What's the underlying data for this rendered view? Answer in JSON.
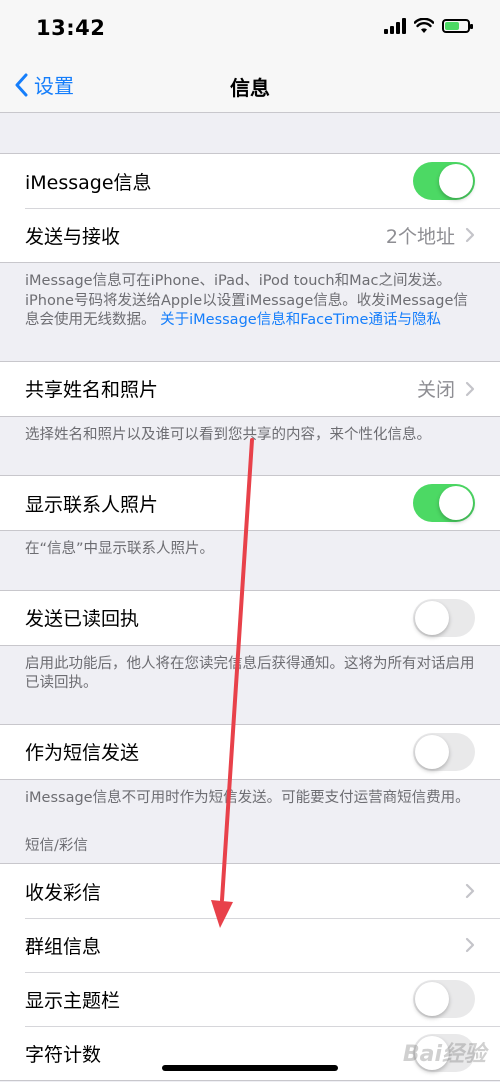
{
  "status_bar": {
    "time": "13:42"
  },
  "nav": {
    "back_label": "设置",
    "title": "信息"
  },
  "sections": {
    "imessage": {
      "toggle_label": "iMessage信息",
      "toggle_on": true,
      "send_receive_label": "发送与接收",
      "send_receive_value": "2个地址",
      "footer_text": "iMessage信息可在iPhone、iPad、iPod touch和Mac之间发送。iPhone号码将发送给Apple以设置iMessage信息。收发iMessage信息会使用无线数据。",
      "footer_link": "关于iMessage信息和FaceTime通话与隐私"
    },
    "share_name": {
      "label": "共享姓名和照片",
      "value": "关闭",
      "footer": "选择姓名和照片以及谁可以看到您共享的内容，来个性化信息。"
    },
    "contact_photos": {
      "label": "显示联系人照片",
      "toggle_on": true,
      "footer": "在“信息”中显示联系人照片。"
    },
    "read_receipts": {
      "label": "发送已读回执",
      "toggle_on": false,
      "footer": "启用此功能后，他人将在您读完信息后获得通知。这将为所有对话启用已读回执。"
    },
    "send_as_sms": {
      "label": "作为短信发送",
      "toggle_on": false,
      "footer": "iMessage信息不可用时作为短信发送。可能要支付运营商短信费用。"
    },
    "sms_mms": {
      "header": "短信/彩信",
      "mms_label": "收发彩信",
      "group_label": "群组信息",
      "subject_label": "显示主题栏",
      "subject_on": false,
      "char_count_label": "字符计数"
    }
  },
  "watermark": "Bai经验",
  "colors": {
    "accent": "#157efb",
    "toggle_on": "#4cd964",
    "annotation_arrow": "#e8414a"
  }
}
